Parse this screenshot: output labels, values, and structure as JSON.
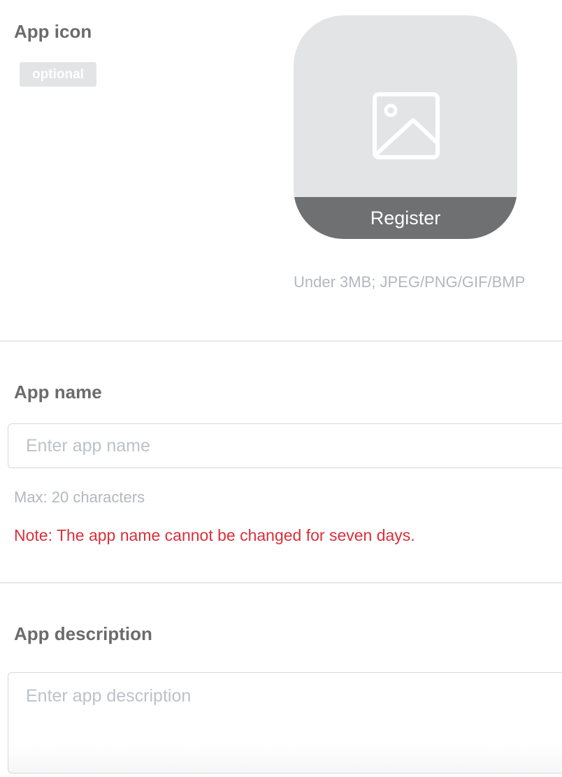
{
  "icon_section": {
    "label": "App icon",
    "badge": "optional",
    "register_label": "Register",
    "hint": "Under 3MB; JPEG/PNG/GIF/BMP"
  },
  "name_section": {
    "label": "App name",
    "placeholder": "Enter app name",
    "value": "",
    "max_hint": "Max: 20 characters",
    "note": "Note: The app name cannot be changed for seven days."
  },
  "description_section": {
    "label": "App description",
    "placeholder": "Enter app description",
    "value": ""
  },
  "colors": {
    "label": "#6b6b6b",
    "hint": "#b3b8bf",
    "warning": "#d9303a",
    "icon_bg": "#e3e4e6",
    "register_bar": "#6f7071"
  },
  "icons": {
    "upload_placeholder": "image-icon"
  }
}
